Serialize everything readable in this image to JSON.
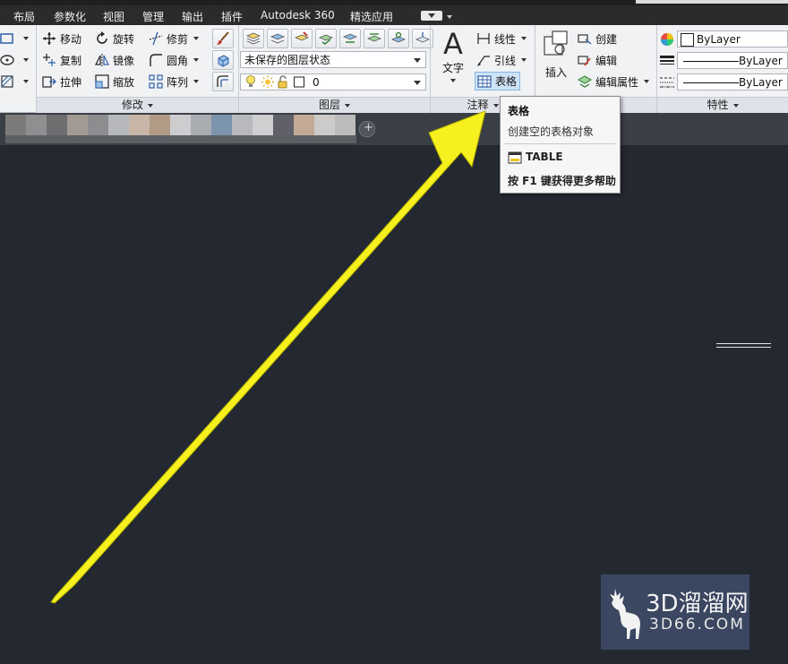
{
  "menu": {
    "items": [
      "布局",
      "参数化",
      "视图",
      "管理",
      "输出",
      "插件",
      "Autodesk 360",
      "精选应用"
    ]
  },
  "modify_panel": {
    "title": "修改",
    "move": "移动",
    "rotate": "旋转",
    "trim": "修剪",
    "copy": "复制",
    "mirror": "镜像",
    "fillet": "圆角",
    "stretch": "拉伸",
    "scale": "缩放",
    "array": "阵列"
  },
  "layers_panel": {
    "title": "图层",
    "layer_state": "未保存的图层状态",
    "current_layer": "0"
  },
  "annotation_panel": {
    "title": "注释",
    "text": "文字",
    "dimension": "线性",
    "leader": "引线",
    "table": "表格"
  },
  "block_panel": {
    "insert": "插入",
    "create": "创建",
    "edit": "编辑",
    "edit_attributes": "编辑属性"
  },
  "properties_panel": {
    "title": "特性",
    "color": "ByLayer",
    "lineweight": "ByLayer",
    "linetype": "ByLayer"
  },
  "tooltip": {
    "title": "表格",
    "description": "创建空的表格对象",
    "command": "TABLE",
    "help": "按 F1 键获得更多帮助"
  },
  "watermark": {
    "brand": "3D溜溜网",
    "domain": "3D66.COM"
  },
  "colors": {
    "canvas": "#232831",
    "arrow": "#f5f01e",
    "ribbon": "#f1f2f4",
    "tooltip_bg": "#f6f6f6"
  }
}
